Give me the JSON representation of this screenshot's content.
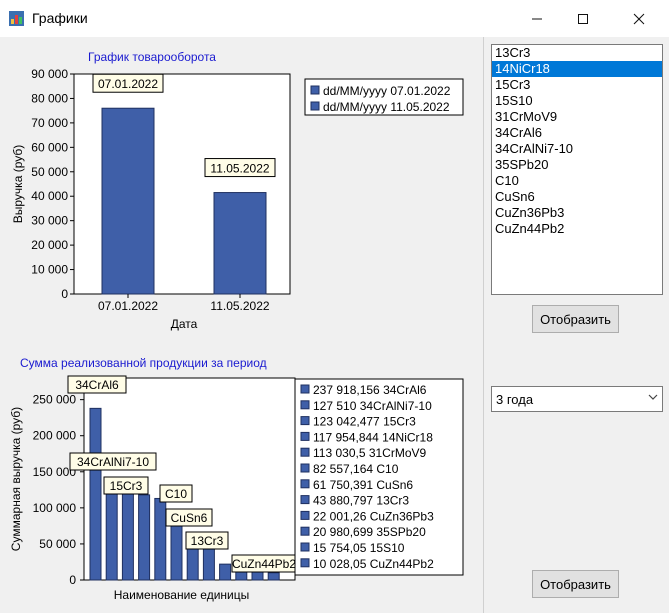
{
  "window": {
    "title": "Графики"
  },
  "chart1": {
    "title": "График товарооборота",
    "ylabel": "Выручка (руб)",
    "xlabel": "Дата",
    "yticks": [
      "90 000",
      "80 000",
      "70 000",
      "60 000",
      "50 000",
      "40 000",
      "30 000",
      "20 000",
      "10 000",
      "0"
    ],
    "legend": [
      "dd/MM/yyyy 07.01.2022",
      "dd/MM/yyyy 11.05.2022"
    ]
  },
  "chart2": {
    "title": "Сумма реализованной продукции за период",
    "ylabel": "Суммарная выручка (руб)",
    "xlabel": "Наименование единицы",
    "yticks": [
      "250 000",
      "200 000",
      "150 000",
      "100 000",
      "50 000",
      "0"
    ],
    "legend": [
      "237 918,156 34CrAl6",
      "127 510 34CrAlNi7-10",
      "123 042,477 15Cr3",
      "117 954,844 14NiCr18",
      "113 030,5 31CrMoV9",
      "82 557,164 C10",
      "61 750,391 CuSn6",
      "43 880,797 13Cr3",
      "22 001,26 CuZn36Pb3",
      "20 980,699 35SPb20",
      "15 754,05 15S10",
      "10 028,05 CuZn44Pb2"
    ]
  },
  "chart_data": [
    {
      "type": "bar",
      "title": "График товарооборота",
      "xlabel": "Дата",
      "ylabel": "Выручка (руб)",
      "ylim": [
        0,
        90000
      ],
      "categories": [
        "07.01.2022",
        "11.05.2022"
      ],
      "values": [
        76000,
        41500
      ],
      "data_labels": [
        "07.01.2022",
        "11.05.2022"
      ],
      "color": "#3f5fa8"
    },
    {
      "type": "bar",
      "title": "Сумма реализованной продукции за период",
      "xlabel": "Наименование единицы",
      "ylabel": "Суммарная выручка (руб)",
      "ylim": [
        0,
        280000
      ],
      "categories": [
        "34CrAl6",
        "34CrAlNi7-10",
        "15Cr3",
        "14NiCr18",
        "31CrMoV9",
        "C10",
        "CuSn6",
        "13Cr3",
        "CuZn36Pb3",
        "35SPb20",
        "15S10",
        "CuZn44Pb2"
      ],
      "values": [
        237918.156,
        127510,
        123042.477,
        117954.844,
        113030.5,
        82557.164,
        61750.391,
        43880.797,
        22001.26,
        20980.699,
        15754.05,
        10028.05
      ],
      "data_labels": [
        "34CrAl6",
        "34CrAlNi7-10",
        "15Cr3",
        "C10",
        "CuSn6",
        "13Cr3",
        "CuZn44Pb2"
      ],
      "color": "#3f5fa8"
    }
  ],
  "listbox": {
    "items": [
      "13Cr3",
      "14NiCr18",
      "15Cr3",
      "15S10",
      "31CrMoV9",
      "34CrAl6",
      "34CrAlNi7-10",
      "35SPb20",
      "C10",
      "CuSn6",
      "CuZn36Pb3",
      "CuZn44Pb2"
    ],
    "selected": "14NiCr18"
  },
  "buttons": {
    "show1": "Отобразить",
    "show2": "Отобразить"
  },
  "period_combo": {
    "value": "3 года"
  }
}
